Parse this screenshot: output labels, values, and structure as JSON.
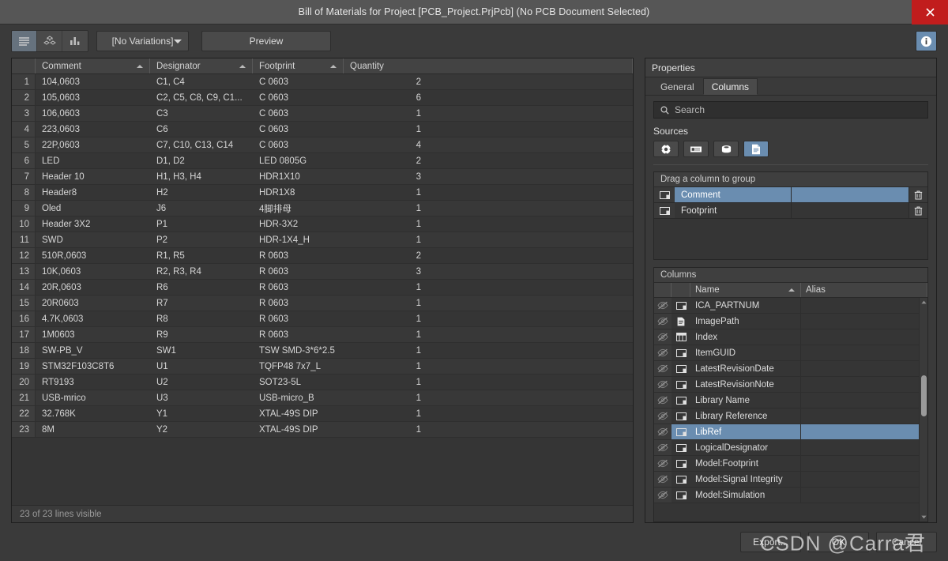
{
  "window": {
    "title": "Bill of Materials for Project [PCB_Project.PrjPcb] (No PCB Document Selected)",
    "close_label": "×"
  },
  "toolbar": {
    "view_buttons": [
      {
        "name": "list-view",
        "icon": "list-icon",
        "active": true
      },
      {
        "name": "blocks-view",
        "icon": "blocks-icon",
        "active": false
      },
      {
        "name": "chart-view",
        "icon": "bar-chart-icon",
        "active": false
      }
    ],
    "variations_value": "[No Variations]",
    "preview_label": "Preview",
    "info_icon": "info-icon"
  },
  "grid": {
    "columns": [
      "",
      "Comment",
      "Designator",
      "Footprint",
      "Quantity"
    ],
    "sorted_columns": [
      "Comment",
      "Designator",
      "Footprint"
    ],
    "status": "23 of 23 lines visible",
    "rows": [
      {
        "n": "1",
        "comment": "104,0603",
        "designator": "C1, C4",
        "footprint": "C 0603",
        "qty": "2"
      },
      {
        "n": "2",
        "comment": "105,0603",
        "designator": "C2, C5, C8, C9, C1...",
        "footprint": "C 0603",
        "qty": "6"
      },
      {
        "n": "3",
        "comment": "106,0603",
        "designator": "C3",
        "footprint": "C 0603",
        "qty": "1"
      },
      {
        "n": "4",
        "comment": "223,0603",
        "designator": "C6",
        "footprint": "C 0603",
        "qty": "1"
      },
      {
        "n": "5",
        "comment": "22P,0603",
        "designator": "C7, C10, C13, C14",
        "footprint": "C 0603",
        "qty": "4"
      },
      {
        "n": "6",
        "comment": "LED",
        "designator": "D1, D2",
        "footprint": "LED 0805G",
        "qty": "2"
      },
      {
        "n": "7",
        "comment": "Header 10",
        "designator": "H1, H3, H4",
        "footprint": "HDR1X10",
        "qty": "3"
      },
      {
        "n": "8",
        "comment": "Header8",
        "designator": "H2",
        "footprint": "HDR1X8",
        "qty": "1"
      },
      {
        "n": "9",
        "comment": "Oled",
        "designator": "J6",
        "footprint": "4脚排母",
        "qty": "1"
      },
      {
        "n": "10",
        "comment": "Header 3X2",
        "designator": "P1",
        "footprint": "HDR-3X2",
        "qty": "1"
      },
      {
        "n": "11",
        "comment": "SWD",
        "designator": "P2",
        "footprint": "HDR-1X4_H",
        "qty": "1"
      },
      {
        "n": "12",
        "comment": "510R,0603",
        "designator": "R1, R5",
        "footprint": "R 0603",
        "qty": "2"
      },
      {
        "n": "13",
        "comment": "10K,0603",
        "designator": "R2, R3, R4",
        "footprint": "R 0603",
        "qty": "3"
      },
      {
        "n": "14",
        "comment": "20R,0603",
        "designator": "R6",
        "footprint": "R 0603",
        "qty": "1"
      },
      {
        "n": "15",
        "comment": "20R0603",
        "designator": "R7",
        "footprint": "R 0603",
        "qty": "1"
      },
      {
        "n": "16",
        "comment": "4.7K,0603",
        "designator": "R8",
        "footprint": "R 0603",
        "qty": "1"
      },
      {
        "n": "17",
        "comment": "1M0603",
        "designator": "R9",
        "footprint": "R 0603",
        "qty": "1"
      },
      {
        "n": "18",
        "comment": "SW-PB_V",
        "designator": "SW1",
        "footprint": "TSW SMD-3*6*2.5",
        "qty": "1"
      },
      {
        "n": "19",
        "comment": "STM32F103C8T6",
        "designator": "U1",
        "footprint": "TQFP48 7x7_L",
        "qty": "1"
      },
      {
        "n": "20",
        "comment": "RT9193",
        "designator": "U2",
        "footprint": "SOT23-5L",
        "qty": "1"
      },
      {
        "n": "21",
        "comment": "USB-mrico",
        "designator": "U3",
        "footprint": "USB-micro_B",
        "qty": "1"
      },
      {
        "n": "22",
        "comment": "32.768K",
        "designator": "Y1",
        "footprint": "XTAL-49S DIP",
        "qty": "1"
      },
      {
        "n": "23",
        "comment": "8M",
        "designator": "Y2",
        "footprint": "XTAL-49S DIP",
        "qty": "1"
      }
    ]
  },
  "properties": {
    "title": "Properties",
    "tabs": [
      {
        "label": "General",
        "active": false
      },
      {
        "label": "Columns",
        "active": true
      }
    ],
    "search_placeholder": "Search",
    "search_value": "",
    "sources_label": "Sources",
    "sources": [
      {
        "name": "component-source",
        "icon": "target-icon",
        "active": false
      },
      {
        "name": "pcb-source",
        "icon": "chip-icon",
        "active": false
      },
      {
        "name": "database-source",
        "icon": "database-icon",
        "active": false
      },
      {
        "name": "document-source",
        "icon": "document-icon",
        "active": true
      }
    ],
    "group": {
      "header": "Drag a column to group",
      "rows": [
        {
          "name": "Comment",
          "alias": "",
          "selected": true,
          "icon": "column-icon",
          "delete_icon": "trash-icon"
        },
        {
          "name": "Footprint",
          "alias": "",
          "selected": false,
          "icon": "column-icon",
          "delete_icon": "trash-icon"
        }
      ]
    },
    "columns_panel": {
      "title": "Columns",
      "headers": {
        "name": "Name",
        "alias": "Alias"
      },
      "sorted_by": "Name",
      "rows": [
        {
          "name": "ICA_PARTNUM",
          "alias": "",
          "selected": false,
          "icon": "column-icon",
          "visibility_icon": "eye-off-icon"
        },
        {
          "name": "ImagePath",
          "alias": "",
          "selected": false,
          "icon": "document-icon",
          "visibility_icon": "eye-off-icon"
        },
        {
          "name": "Index",
          "alias": "",
          "selected": false,
          "icon": "table-icon",
          "visibility_icon": "eye-off-icon"
        },
        {
          "name": "ItemGUID",
          "alias": "",
          "selected": false,
          "icon": "column-icon",
          "visibility_icon": "eye-off-icon"
        },
        {
          "name": "LatestRevisionDate",
          "alias": "",
          "selected": false,
          "icon": "column-icon",
          "visibility_icon": "eye-off-icon"
        },
        {
          "name": "LatestRevisionNote",
          "alias": "",
          "selected": false,
          "icon": "column-icon",
          "visibility_icon": "eye-off-icon"
        },
        {
          "name": "Library Name",
          "alias": "",
          "selected": false,
          "icon": "column-icon",
          "visibility_icon": "eye-off-icon"
        },
        {
          "name": "Library Reference",
          "alias": "",
          "selected": false,
          "icon": "column-icon",
          "visibility_icon": "eye-off-icon"
        },
        {
          "name": "LibRef",
          "alias": "",
          "selected": true,
          "icon": "column-icon",
          "visibility_icon": "eye-off-icon"
        },
        {
          "name": "LogicalDesignator",
          "alias": "",
          "selected": false,
          "icon": "column-icon",
          "visibility_icon": "eye-off-icon"
        },
        {
          "name": "Model:Footprint",
          "alias": "",
          "selected": false,
          "icon": "column-icon",
          "visibility_icon": "eye-off-icon"
        },
        {
          "name": "Model:Signal Integrity",
          "alias": "",
          "selected": false,
          "icon": "column-icon",
          "visibility_icon": "eye-off-icon"
        },
        {
          "name": "Model:Simulation",
          "alias": "",
          "selected": false,
          "icon": "column-icon",
          "visibility_icon": "eye-off-icon"
        }
      ]
    }
  },
  "footer": {
    "export_label": "Export...",
    "ok_label": "OK",
    "cancel_label": "Cancel",
    "watermark": "CSDN @Carra君"
  },
  "colors": {
    "accent": "#6a8db0",
    "close": "#c11d1d",
    "window_bg": "#3a3a3a",
    "grid_bg": "#353535"
  }
}
